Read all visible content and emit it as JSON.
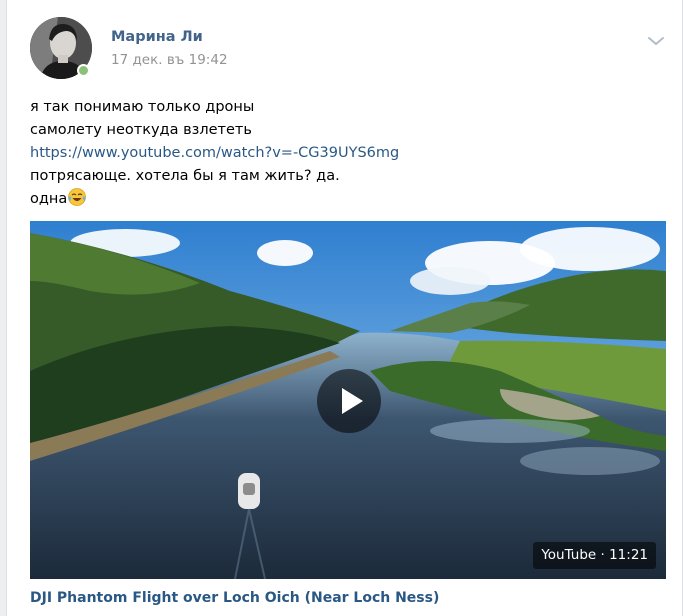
{
  "post": {
    "author_name": "Марина Ли",
    "date": "17 дек. въ 19:42",
    "author_online": true,
    "text_lines": [
      "я так понимаю только дроны",
      "самолету неоткуда взлететь"
    ],
    "link": "https://www.youtube.com/watch?v=-CG39UYS6mg",
    "text_after_link": "потрясающе. хотела бы я там жить? да.",
    "last_line": "одна",
    "emoji_icon": "face-with-tears-of-joy-emoji"
  },
  "video": {
    "source": "YouTube",
    "separator": " · ",
    "duration": "11:21",
    "title": "DJI Phantom Flight over Loch Oich (Near Loch Ness)",
    "play_icon": "play-icon"
  },
  "icons": {
    "menu": "chevron-down-icon",
    "online": "online-indicator"
  },
  "colors": {
    "link": "#2a5885",
    "author": "#42648b",
    "date": "#939393",
    "online": "#8ac176",
    "background": "#edeef0"
  }
}
